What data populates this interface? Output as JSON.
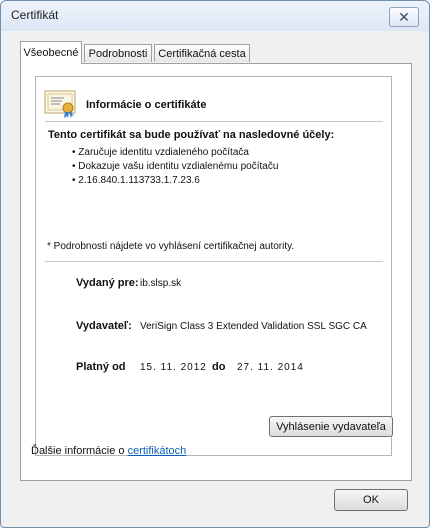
{
  "window": {
    "title": "Certifikát",
    "close_glyph": "✕"
  },
  "tabs": [
    {
      "label": "Všeobecné",
      "active": true
    },
    {
      "label": "Podrobnosti",
      "active": false
    },
    {
      "label": "Certifikačná cesta",
      "active": false
    }
  ],
  "info": {
    "header": "Informácie o certifikáte",
    "icon": "certificate-icon",
    "purpose_heading": "Tento certifikát sa bude používať na nasledovné účely:",
    "purposes": [
      "• Zaručuje identitu vzdialeného počítača",
      "• Dokazuje vašu identitu vzdialenému počítaču",
      "• 2.16.840.1.113733.1.7.23.6"
    ],
    "note": "* Podrobnosti nájdete vo vyhlásení certifikačnej autority.",
    "issued_to_label": "Vydaný pre:",
    "issued_to_value": "ib.slsp.sk",
    "issuer_label": "Vydavateľ:",
    "issuer_value": "VeriSign Class 3 Extended Validation SSL SGC CA",
    "valid_from_label": "Platný od",
    "valid_from_value": "15. 11. 2012",
    "valid_to_label": "do",
    "valid_to_value": "27. 11. 2014"
  },
  "buttons": {
    "issuer_statement": "Vyhlásenie vydavateľa",
    "ok": "OK"
  },
  "more_info": {
    "prefix": "Ďalšie informácie o ",
    "link": "certifikátoch"
  },
  "colors": {
    "accent_link": "#0b5fb8",
    "window_border": "#6f8fb0"
  }
}
